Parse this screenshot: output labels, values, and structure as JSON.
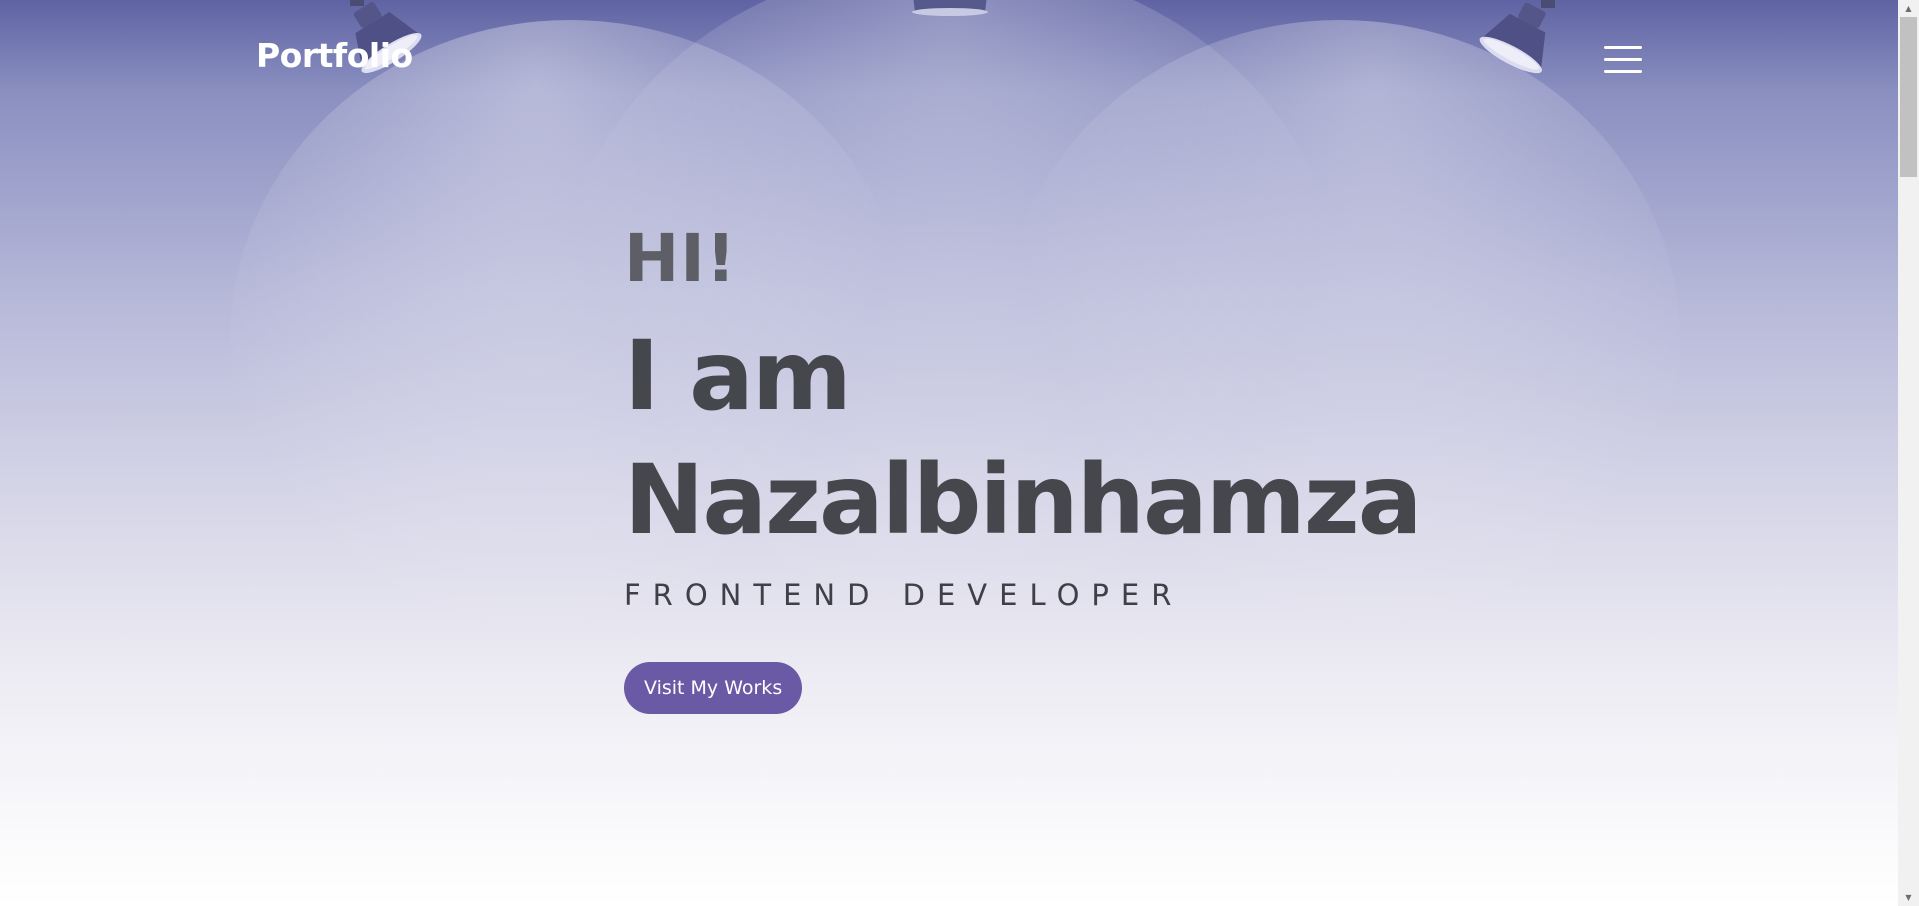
{
  "nav": {
    "logo": "Portfolio",
    "menu_icon": "hamburger-menu-icon"
  },
  "hero": {
    "greeting": "HI!",
    "intro_line1": "I am",
    "intro_line2": "Nazalbinhamza",
    "role": "FRONTEND DEVELOPER",
    "cta_label": "Visit My Works"
  },
  "decor": {
    "lamp_icon": "spotlight-icon"
  },
  "scrollbar": {
    "up_icon": "scroll-up-arrow-icon",
    "down_icon": "scroll-down-arrow-icon"
  },
  "colors": {
    "accent": "#6a5aa5",
    "heading": "#45474d",
    "header_bg": "#5f63a3"
  }
}
